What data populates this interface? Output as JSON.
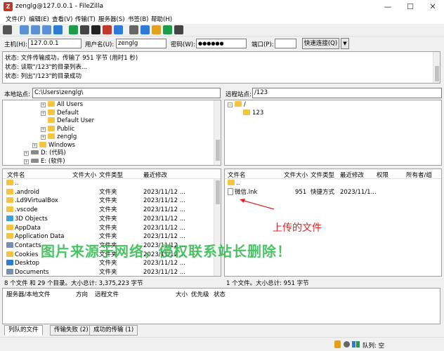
{
  "window": {
    "title": "zenglg@127.0.0.1 - FileZilla",
    "app_icon_letter": "Z",
    "minimize": "—",
    "maximize": "☐",
    "close": "✕"
  },
  "menu": [
    "文件(F)",
    "编辑(E)",
    "查看(V)",
    "传输(T)",
    "服务器(S)",
    "书签(B)",
    "帮助(H)"
  ],
  "toolbar_icons": [
    {
      "name": "site-manager-icon",
      "color": "#555555"
    },
    {
      "name": "toggle-log-icon",
      "color": "#5b8fd6"
    },
    {
      "name": "toggle-local-tree-icon",
      "color": "#5b8fd6"
    },
    {
      "name": "toggle-remote-tree-icon",
      "color": "#5b8fd6"
    },
    {
      "name": "toggle-queue-icon",
      "color": "#2e7bd6"
    },
    {
      "name": "refresh-icon",
      "color": "#1f9b4a"
    },
    {
      "name": "process-queue-icon",
      "color": "#444444"
    },
    {
      "name": "cancel-icon",
      "color": "#222222"
    },
    {
      "name": "disconnect-icon",
      "color": "#c0392b"
    },
    {
      "name": "reconnect-icon",
      "color": "#2e7bd6"
    },
    {
      "name": "filter-icon",
      "color": "#666666"
    },
    {
      "name": "search-icon",
      "color": "#2e7bd6"
    },
    {
      "name": "compare-icon",
      "color": "#e0a020"
    },
    {
      "name": "sync-browse-icon",
      "color": "#1f9b4a"
    },
    {
      "name": "find-files-icon",
      "color": "#444444"
    }
  ],
  "connection": {
    "host_label": "主机(H):",
    "host_value": "127.0.0.1",
    "user_label": "用户名(U):",
    "user_value": "zenglg",
    "pass_label": "密码(W):",
    "pass_value": "●●●●●●",
    "port_label": "端口(P):",
    "port_value": "",
    "quickconnect": "快速连接(Q)",
    "dropdown": "▼"
  },
  "log": [
    "状态: 文件传输成功，传输了 951 字节 (用时1 秒)",
    "状态: 读取\"/123\"的目录列表...",
    "状态: 列出\"/123\"的目录成功"
  ],
  "local": {
    "site_label": "本地站点:",
    "site_path": "C:\\Users\\zenglg\\",
    "tree": [
      {
        "label": "All Users",
        "expander": "+"
      },
      {
        "label": "Default",
        "expander": "+"
      },
      {
        "label": "Default User",
        "expander": ""
      },
      {
        "label": "Public",
        "expander": "+"
      },
      {
        "label": "zenglg",
        "expander": "+"
      },
      {
        "label": "Windows",
        "expander": "+"
      },
      {
        "label": "D: (代码)",
        "expander": "+"
      },
      {
        "label": "E: (软件)",
        "expander": "+"
      }
    ],
    "columns": [
      "文件名",
      "文件大小",
      "文件类型",
      "最近修改"
    ],
    "files": [
      {
        "name": "..",
        "size": "",
        "type": "",
        "modified": "",
        "color": "#f6c343"
      },
      {
        "name": ".android",
        "size": "",
        "type": "文件夹",
        "modified": "2023/11/12 ...",
        "color": "#f6c343"
      },
      {
        "name": ".Ld9VirtualBox",
        "size": "",
        "type": "文件夹",
        "modified": "2023/11/12 ...",
        "color": "#f6c343"
      },
      {
        "name": ".vscode",
        "size": "",
        "type": "文件夹",
        "modified": "2023/11/12 ...",
        "color": "#f6c343"
      },
      {
        "name": "3D Objects",
        "size": "",
        "type": "文件夹",
        "modified": "2023/11/12 ...",
        "color": "#3aa0e0"
      },
      {
        "name": "AppData",
        "size": "",
        "type": "文件夹",
        "modified": "2023/11/12 ...",
        "color": "#f6c343"
      },
      {
        "name": "Application Data",
        "size": "",
        "type": "文件夹",
        "modified": "2023/11/12 ...",
        "color": "#f6c343"
      },
      {
        "name": "Contacts",
        "size": "",
        "type": "文件夹",
        "modified": "2023/11/12 ...",
        "color": "#7a8fb0"
      },
      {
        "name": "Cookies",
        "size": "",
        "type": "文件夹",
        "modified": "2023/11/12 ...",
        "color": "#f6c343"
      },
      {
        "name": "Desktop",
        "size": "",
        "type": "文件夹",
        "modified": "2023/11/12 ...",
        "color": "#2e7bd6"
      },
      {
        "name": "Documents",
        "size": "",
        "type": "文件夹",
        "modified": "2023/11/12 ...",
        "color": "#7a8fb0"
      }
    ],
    "status": "8 个文件 和 29 个目录。大小总计: 3,375,223 字节"
  },
  "remote": {
    "site_label": "远程站点:",
    "site_path": "/123",
    "tree": [
      {
        "label": "/",
        "expander": "−"
      },
      {
        "label": "123",
        "expander": ""
      }
    ],
    "columns": [
      "文件名",
      "文件大小",
      "文件类型",
      "最近修改",
      "权限",
      "所有者/组"
    ],
    "files": [
      {
        "name": "..",
        "size": "",
        "type": "",
        "modified": "",
        "kind": "folder"
      },
      {
        "name": "微信.lnk",
        "size": "951",
        "type": "快捷方式",
        "modified": "2023/11/1...",
        "kind": "file"
      }
    ],
    "status": "1 个文件。大小总计: 951 字节"
  },
  "queue": {
    "columns": [
      "服务器/本地文件",
      "方向",
      "远程文件",
      "大小",
      "优先级",
      "状态"
    ]
  },
  "tabs": [
    "列队的文件",
    "传输失败 (2)",
    "成功的传输 (1)"
  ],
  "statusbar": {
    "queue_label": "队列: 空"
  },
  "annotation": "上传的文件",
  "watermark": "图片来源于网络，侵权联系站长删除！"
}
